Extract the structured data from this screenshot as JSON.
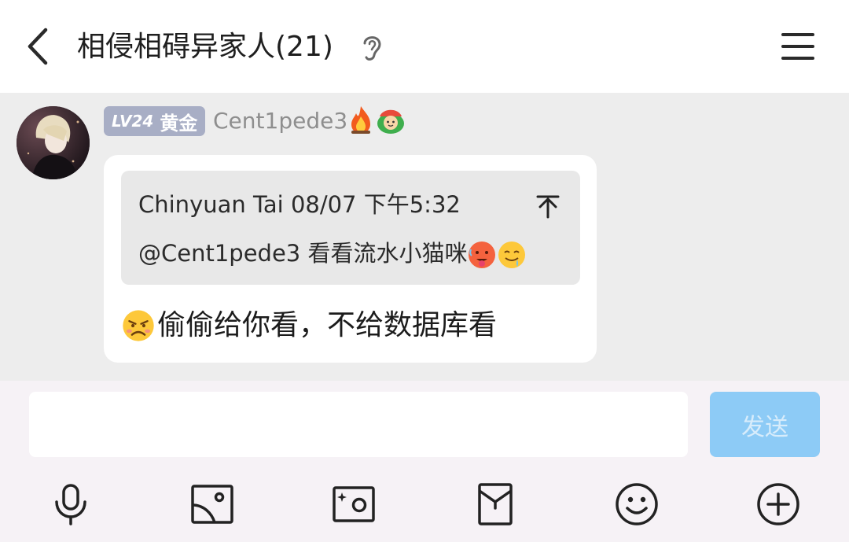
{
  "header": {
    "title": "相侵相碍异家人(21)",
    "back_icon": "chevron-left-icon",
    "ear_icon": "ear-icon",
    "menu_icon": "hamburger-menu-icon"
  },
  "message": {
    "level": "LV24",
    "rank": "黄金",
    "sender": "Cent1pede3",
    "emblems": [
      "fire-emblem-icon",
      "green-face-emblem-icon"
    ],
    "quote": {
      "meta": "Chinyuan Tai 08/07 下午5:32",
      "text": "@Cent1pede3 看看流水小猫咪",
      "text_emojis": [
        "hot-face-emoji",
        "drooling-face-emoji"
      ],
      "jump_icon": "scroll-to-top-icon"
    },
    "text": "偷偷给你看，不给数据库看",
    "text_emoji": "pouting-face-emoji"
  },
  "composer": {
    "placeholder": "",
    "send_label": "发送",
    "tools": [
      "microphone-icon",
      "image-icon",
      "camera-icon",
      "red-envelope-icon",
      "smiley-icon",
      "plus-circle-icon"
    ]
  },
  "colors": {
    "accent": "#8dcbf6",
    "badge": "#a8aec5",
    "header_bg": "#ffffff",
    "chat_bg": "#ededed"
  }
}
